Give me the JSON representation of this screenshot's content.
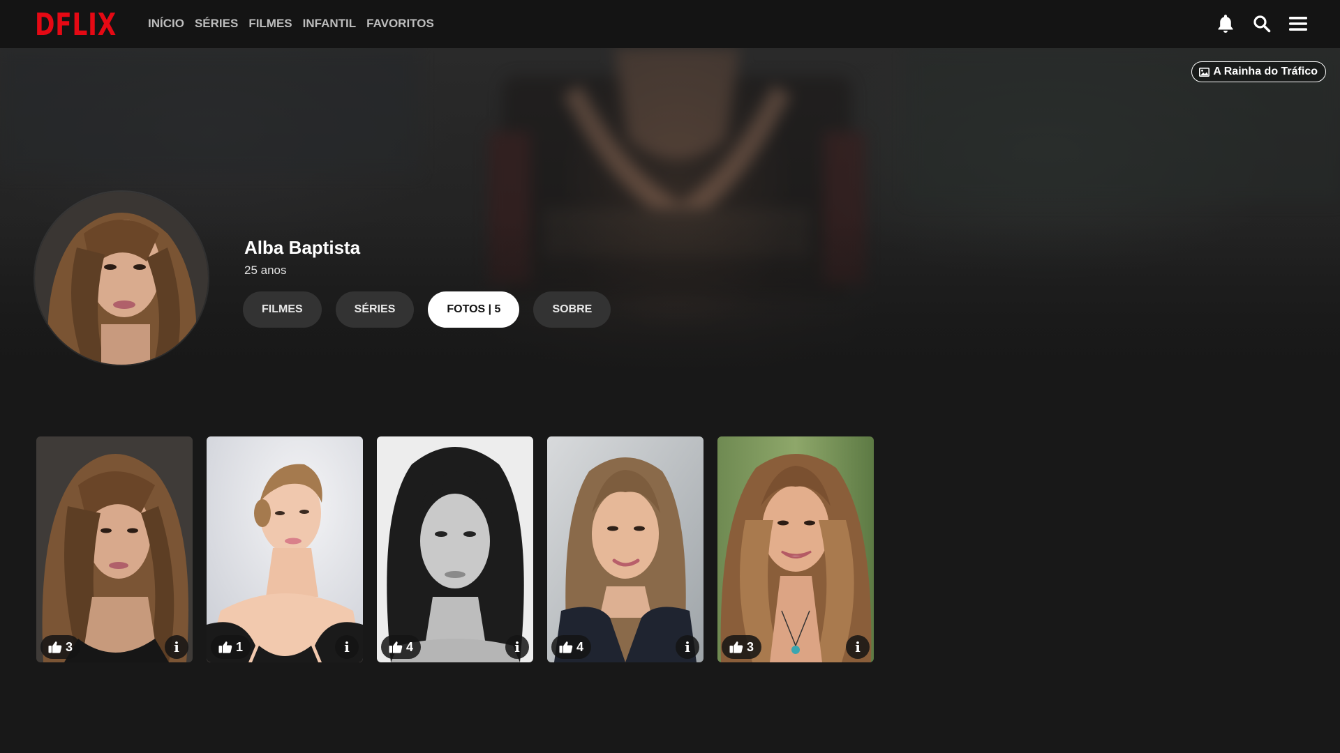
{
  "brand": {
    "logo": "DFLIX",
    "color": "#e50914"
  },
  "nav": {
    "items": [
      "INÍCIO",
      "SÉRIES",
      "FILMES",
      "INFANTIL",
      "FAVORITOS"
    ]
  },
  "top_icons": [
    "bell-icon",
    "search-icon",
    "menu-icon"
  ],
  "hero": {
    "chip_label": "A Rainha do Tráfico"
  },
  "profile": {
    "name": "Alba Baptista",
    "age": "25 anos",
    "tabs": [
      {
        "label": "FILMES",
        "active": false
      },
      {
        "label": "SÉRIES",
        "active": false
      },
      {
        "label": "FOTOS | 5",
        "active": true
      },
      {
        "label": "SOBRE",
        "active": false
      }
    ]
  },
  "photos": [
    {
      "likes": "3",
      "style": "color-curly-dark-bg"
    },
    {
      "likes": "1",
      "style": "color-bun-light-bg"
    },
    {
      "likes": "4",
      "style": "black-and-white"
    },
    {
      "likes": "4",
      "style": "color-outdoor-blazer"
    },
    {
      "likes": "3",
      "style": "color-smiling-green-bg"
    }
  ]
}
